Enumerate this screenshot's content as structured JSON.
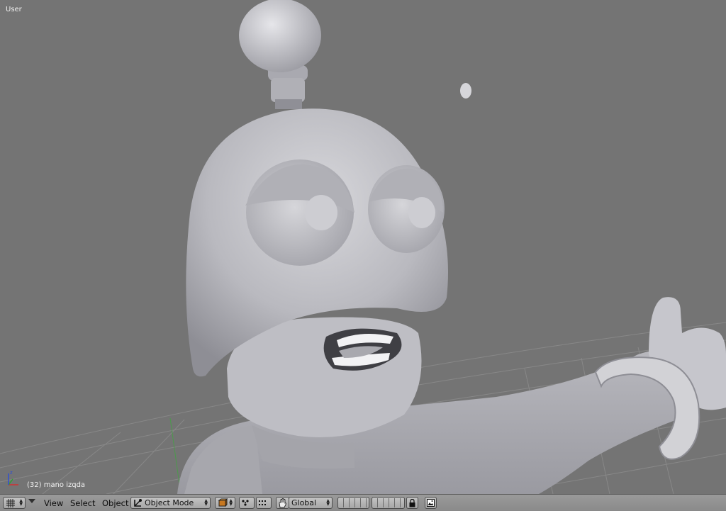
{
  "viewport": {
    "view_name": "User",
    "object_info": "(32) mano izqda"
  },
  "header": {
    "editor_type_icon": "grid-icon",
    "menus": [
      "View",
      "Select",
      "Object"
    ],
    "mode_icon": "object-mode-icon",
    "mode_label": "Object Mode",
    "shading_icon": "solid-shading-icon",
    "pivot_icon": "pivot-icon",
    "manipulator_icon": "hand-icon",
    "orientation_label": "Global",
    "lock_icon": "lock-icon",
    "render_icon": "render-icon"
  },
  "colors": {
    "background": "#747474",
    "header": "#929292",
    "model": "#c8c8cc"
  }
}
